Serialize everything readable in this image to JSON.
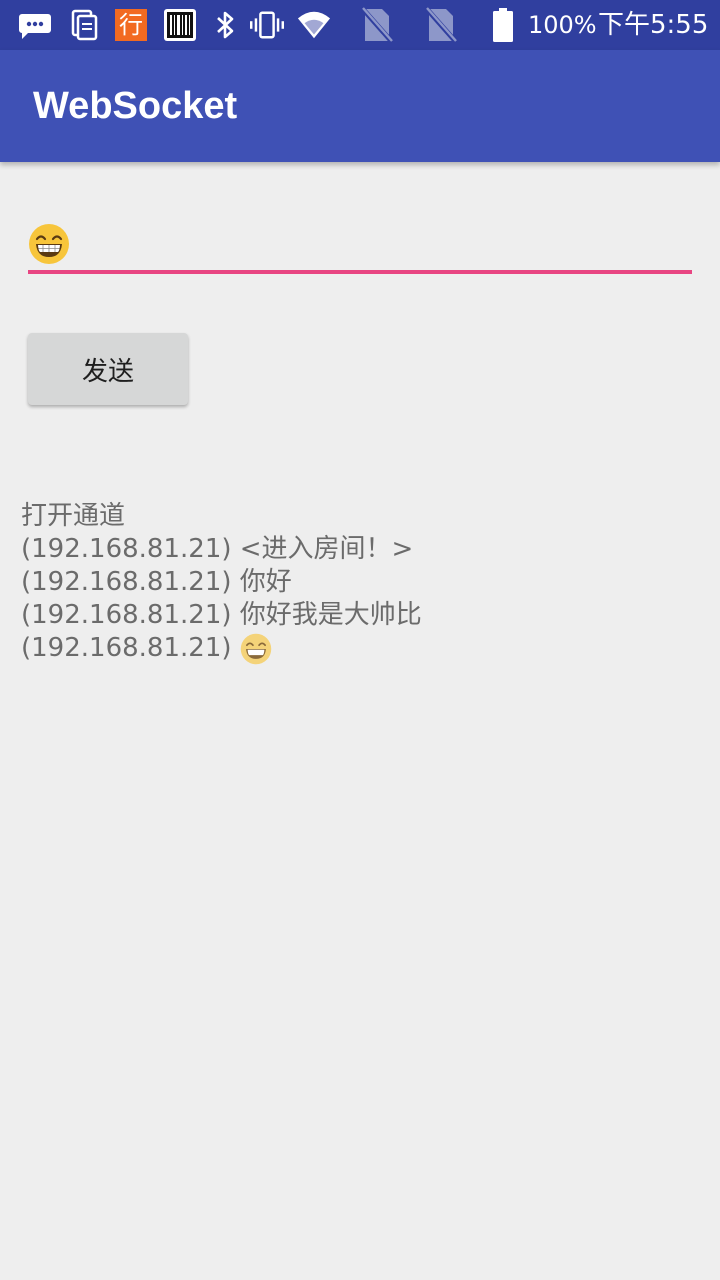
{
  "status_bar": {
    "battery_text": "100%",
    "time": "下午5:55",
    "icons": [
      "chat-bubble-icon",
      "documents-icon",
      "app-badge-icon",
      "barcode-icon",
      "bluetooth-icon",
      "vibrate-icon",
      "wifi-icon",
      "no-sim-icon",
      "no-sim-icon",
      "battery-icon"
    ],
    "app_badge_text": "行"
  },
  "app_bar": {
    "title": "WebSocket",
    "color": "#3f51b5"
  },
  "input": {
    "value_icon": "grinning-emoji-icon",
    "underline_color": "#e84582"
  },
  "send_button": {
    "label": "发送"
  },
  "log": {
    "lines": [
      {
        "text": "打开通道"
      },
      {
        "text": "(192.168.81.21) <进入房间！>"
      },
      {
        "text": "(192.168.81.21) 你好"
      },
      {
        "text": "(192.168.81.21) 你好我是大帅比"
      },
      {
        "text": "(192.168.81.21)",
        "icon": "grinning-emoji-icon"
      }
    ]
  }
}
